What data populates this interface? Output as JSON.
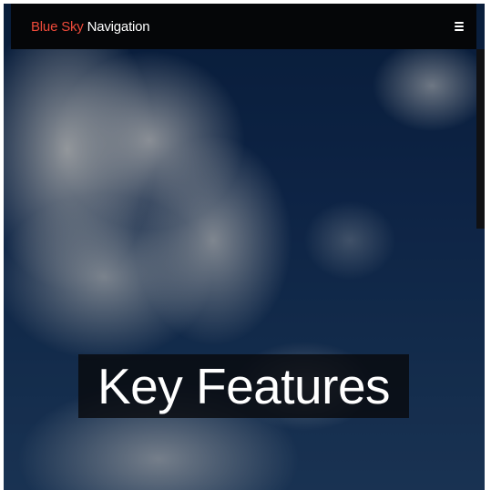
{
  "navbar": {
    "brand_accent": "Blue Sky",
    "brand_rest": " Navigation",
    "menu_icon": "hamburger-menu-icon"
  },
  "hero": {
    "title": "Key Features"
  },
  "colors": {
    "brand_accent": "#ee4a3a",
    "navbar_background": "#050608",
    "text": "#ffffff"
  }
}
